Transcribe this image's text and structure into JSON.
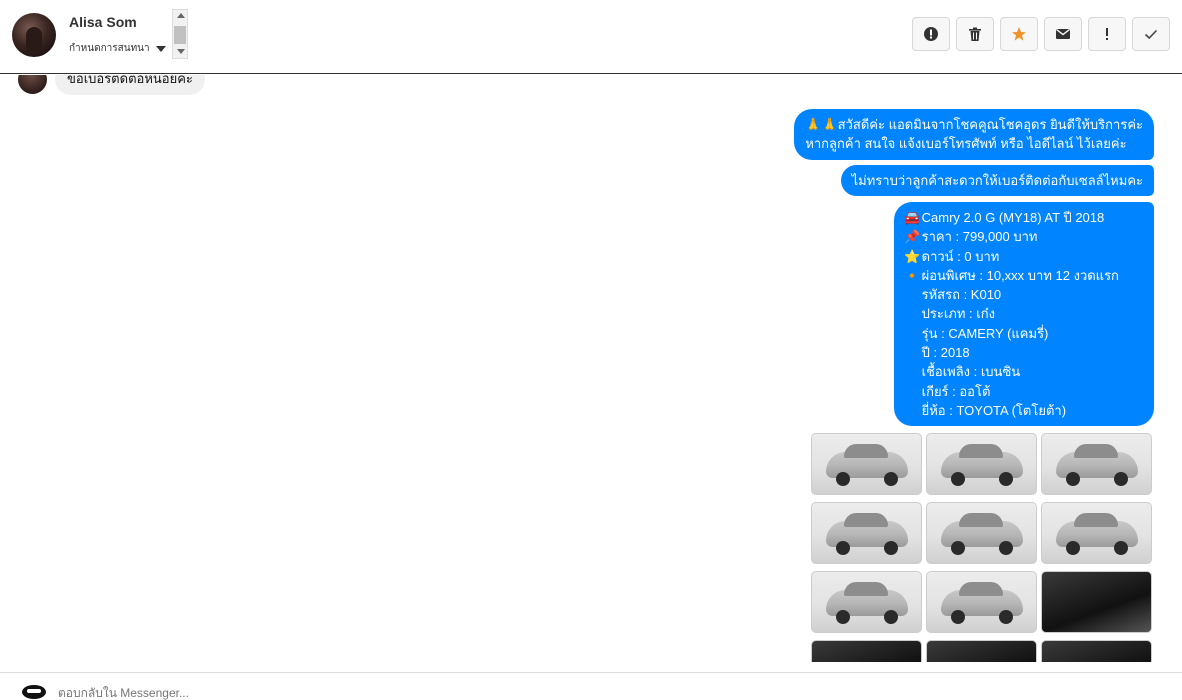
{
  "header": {
    "user_name": "Alisa Som",
    "status_label": "กำหนดการสนทนา"
  },
  "toolbar": {
    "buttons": [
      {
        "name": "report",
        "icon": "alert-circle-icon"
      },
      {
        "name": "delete",
        "icon": "trash-icon"
      },
      {
        "name": "star",
        "icon": "star-icon",
        "color": "#f0932b"
      },
      {
        "name": "mail",
        "icon": "envelope-icon"
      },
      {
        "name": "important",
        "icon": "exclamation-icon"
      },
      {
        "name": "done",
        "icon": "check-icon"
      }
    ]
  },
  "messages": {
    "incoming_top": "ขอเบอร์ติดต่อหน่อยค่ะ",
    "out1": {
      "line1": "🙏🙏สวัสดีค่ะ แอดมินจากโชคคูณโชคอุดร ยินดีให้บริการค่ะ",
      "line2": "หากลูกค้า สนใจ แจ้งเบอร์โทรศัพท์ หรือ ไอดีไลน์ ไว้เลยค่ะ"
    },
    "out2": "ไม่ทราบว่าลูกค้าสะดวกให้เบอร์ติดต่อกับเซลล์ไหมคะ",
    "out3": {
      "lines": [
        {
          "emoji": "🚘",
          "text": "Camry 2.0 G (MY18) AT ปี 2018"
        },
        {
          "emoji": "📌",
          "text": "ราคา : 799,000 บาท"
        },
        {
          "emoji": "⭐",
          "text": "ดาวน์ : 0 บาท"
        },
        {
          "emoji": "🔸",
          "text": " ผ่อนพิเศษ : 10,xxx บาท 12 งวดแรก"
        },
        {
          "emoji": "",
          "text": "รหัสรถ : K010"
        },
        {
          "emoji": "",
          "text": "ประเภท : เก๋ง"
        },
        {
          "emoji": "",
          "text": "รุ่น : CAMERY (แคมรี่)"
        },
        {
          "emoji": "",
          "text": "ปี : 2018"
        },
        {
          "emoji": "",
          "text": "เชื้อเพลิง : เบนซิน"
        },
        {
          "emoji": "",
          "text": "เกียร์ : ออโต้"
        },
        {
          "emoji": "",
          "text": "ยี่ห้อ : TOYOTA (โตโยต้า)"
        }
      ]
    }
  },
  "gallery": {
    "photos": [
      {
        "kind": "exterior"
      },
      {
        "kind": "exterior"
      },
      {
        "kind": "exterior"
      },
      {
        "kind": "exterior"
      },
      {
        "kind": "exterior"
      },
      {
        "kind": "exterior"
      },
      {
        "kind": "exterior"
      },
      {
        "kind": "exterior"
      },
      {
        "kind": "interior"
      },
      {
        "kind": "interior"
      },
      {
        "kind": "interior"
      },
      {
        "kind": "interior"
      }
    ]
  },
  "composer": {
    "placeholder": "ตอบกลับใน Messenger..."
  }
}
